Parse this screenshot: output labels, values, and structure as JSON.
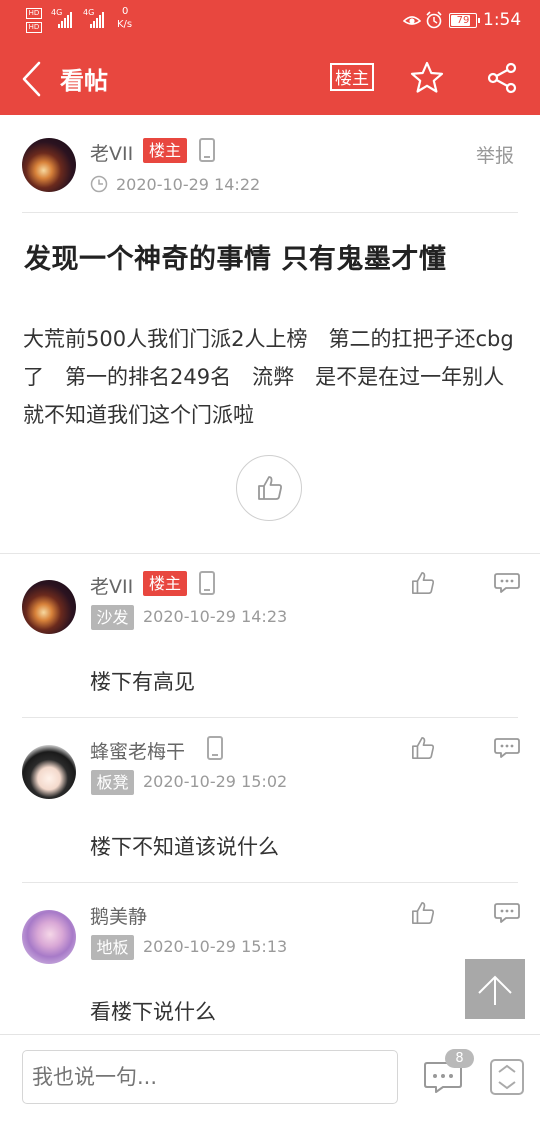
{
  "status_bar": {
    "hd1": "HD",
    "hd2": "HD",
    "net1": "4G",
    "net2": "4G",
    "speed_value": "0",
    "speed_unit": "K/s",
    "battery": "79",
    "battery_level": 0.79,
    "time": "1:54"
  },
  "header": {
    "title": "看帖",
    "louzhu_label": "楼主"
  },
  "post": {
    "author": "老VII",
    "author_badge": "楼主",
    "time": "2020-10-29 14:22",
    "report_label": "举报",
    "title": "发现一个神奇的事情 只有鬼墨才懂",
    "body": "大荒前500人我们门派2人上榜　第二的扛把子还cbg了　第一的排名249名　流弊　是不是在过一年别人就不知道我们这个门派啦"
  },
  "replies": [
    {
      "user": "老VII",
      "badge": "楼主",
      "floor": "沙发",
      "time": "2020-10-29 14:23",
      "text": "楼下有高见"
    },
    {
      "user": "蜂蜜老梅干",
      "floor": "板凳",
      "time": "2020-10-29 15:02",
      "text": "楼下不知道该说什么"
    },
    {
      "user": "鹅美静",
      "floor": "地板",
      "time": "2020-10-29 15:13",
      "text": "看楼下说什么"
    }
  ],
  "bottom": {
    "placeholder": "我也说一句...",
    "comment_count": "8"
  },
  "colors": {
    "accent": "#e8473f",
    "gray_badge": "#b6b6b6"
  }
}
